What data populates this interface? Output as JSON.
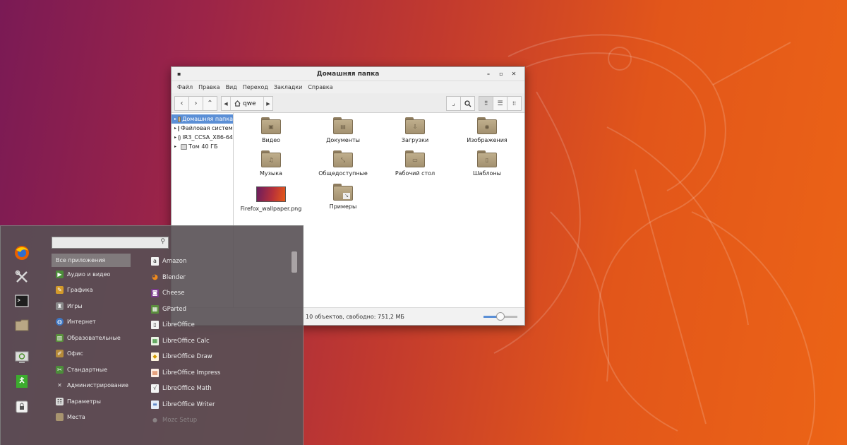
{
  "file_manager": {
    "title": "Домашняя папка",
    "menu": [
      "Файл",
      "Правка",
      "Вид",
      "Переход",
      "Закладки",
      "Справка"
    ],
    "path_crumb": "qwe",
    "sidebar": [
      {
        "label": "Домашняя папка",
        "selected": true
      },
      {
        "label": "Файловая система",
        "selected": false
      },
      {
        "label": "IR3_CCSA_X86-64",
        "selected": false
      },
      {
        "label": "Том 40 ГБ",
        "selected": false
      }
    ],
    "items": [
      {
        "label": "Видео",
        "icon": "video-folder-icon"
      },
      {
        "label": "Документы",
        "icon": "documents-folder-icon"
      },
      {
        "label": "Загрузки",
        "icon": "downloads-folder-icon"
      },
      {
        "label": "Изображения",
        "icon": "pictures-folder-icon"
      },
      {
        "label": "Музыка",
        "icon": "music-folder-icon"
      },
      {
        "label": "Общедоступные",
        "icon": "public-folder-icon"
      },
      {
        "label": "Рабочий стол",
        "icon": "desktop-folder-icon"
      },
      {
        "label": "Шаблоны",
        "icon": "templates-folder-icon"
      },
      {
        "label": "Firefox_wallpaper.png",
        "icon": "image-file-icon"
      },
      {
        "label": "Примеры",
        "icon": "examples-folder-icon"
      }
    ],
    "status": "10 объектов, свободно: 751,2 МБ",
    "zoom_fraction": 0.5
  },
  "menu": {
    "categories": [
      {
        "label": "Все приложения",
        "selected": true
      },
      {
        "label": "Аудио и видео"
      },
      {
        "label": "Графика"
      },
      {
        "label": "Игры"
      },
      {
        "label": "Интернет"
      },
      {
        "label": "Образовательные"
      },
      {
        "label": "Офис"
      },
      {
        "label": "Стандартные"
      },
      {
        "label": "Администрирование"
      },
      {
        "label": "Параметры"
      },
      {
        "label": "Места"
      }
    ],
    "apps": [
      {
        "label": "Amazon"
      },
      {
        "label": "Blender"
      },
      {
        "label": "Cheese"
      },
      {
        "label": "GParted"
      },
      {
        "label": "LibreOffice"
      },
      {
        "label": "LibreOffice Calc"
      },
      {
        "label": "LibreOffice Draw"
      },
      {
        "label": "LibreOffice Impress"
      },
      {
        "label": "LibreOffice Math"
      },
      {
        "label": "LibreOffice Writer"
      },
      {
        "label": "Mozc Setup"
      }
    ],
    "favorites": [
      "firefox-icon",
      "settings-tools-icon",
      "terminal-icon",
      "files-icon",
      "logout-icon",
      "exit-icon",
      "lock-screen-icon"
    ]
  }
}
